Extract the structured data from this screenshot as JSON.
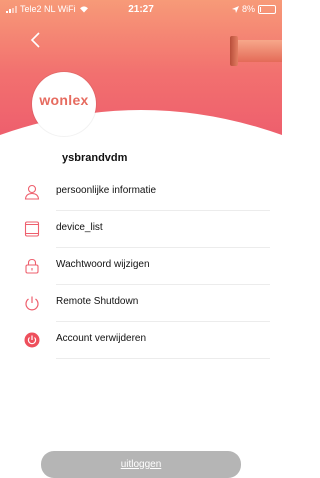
{
  "status_bar": {
    "carrier": "Tele2 NL WiFi",
    "time": "21:27",
    "battery": "8%",
    "battery_level": 0.08
  },
  "header": {
    "back_icon": "chevron-left-icon",
    "logo_text": "wonlex"
  },
  "profile": {
    "username": "ysbrandvdm"
  },
  "menu": {
    "items": [
      {
        "label": "persoonlijke informatie",
        "icon": "person-icon"
      },
      {
        "label": "device_list",
        "icon": "tablet-icon"
      },
      {
        "label": "Wachtwoord wijzigen",
        "icon": "lock-icon"
      },
      {
        "label": "Remote Shutdown",
        "icon": "power-icon"
      },
      {
        "label": "Account verwijderen",
        "icon": "power-filled-icon"
      }
    ]
  },
  "footer": {
    "logout_label": "uitloggen"
  },
  "colors": {
    "accent": "#ee5f6d",
    "header_top": "#f79a78",
    "button_gray": "#b5b5b5"
  }
}
